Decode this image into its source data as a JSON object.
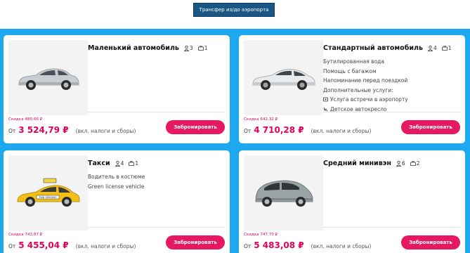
{
  "header": {
    "transfer_button": "Трансфер из/до аэропорта"
  },
  "colors": {
    "panel": "#1ea8f0",
    "accent": "#e3005a",
    "header_button": "#1a5683"
  },
  "cards": [
    {
      "title": "Маленький автомобиль",
      "passengers": "3",
      "luggage": "1",
      "features": [],
      "extras_label": "",
      "extras": [],
      "discount": "Скидка 480,66 ₽",
      "price_from": "От",
      "price": "3 524,79 ₽",
      "price_note": "(вкл. налоги и сборы)",
      "book_label": "Забронировать",
      "car_icon": "sedan-silver",
      "car_color": "#c9ccd0"
    },
    {
      "title": "Стандартный автомобиль",
      "passengers": "4",
      "luggage": "1",
      "features": [
        "Бутилированная вода",
        "Помощь с багажом",
        "Напоминание перед поездкой"
      ],
      "extras_label": "Дополнительные услуги:",
      "extras": [
        {
          "icon": "meet-greet-icon",
          "label": "Услуга встречи в аэропорту"
        },
        {
          "icon": "child-seat-icon",
          "label": "Детское автокресло"
        }
      ],
      "discount": "Скидка 642,32 ₽",
      "price_from": "От",
      "price": "4 710,28 ₽",
      "price_note": "(вкл. налоги и сборы)",
      "book_label": "Забронировать",
      "car_icon": "sedan-white",
      "car_color": "#e9eaec"
    },
    {
      "title": "Такси",
      "passengers": "4",
      "luggage": "1",
      "features": [
        "Водитель в костюме",
        "Green license vehicle"
      ],
      "extras_label": "",
      "extras": [],
      "discount": "Скидка 743,87 ₽",
      "price_from": "От",
      "price": "5 455,04 ₽",
      "price_note": "(вкл. налоги и сборы)",
      "book_label": "Забронировать",
      "car_icon": "taxi-yellow",
      "car_color": "#f2c018",
      "taxi_sign": "TAXI 0000000"
    },
    {
      "title": "Средний минивэн",
      "passengers": "6",
      "luggage": "2",
      "features": [],
      "extras_label": "",
      "extras": [],
      "discount": "Скидка 747,70 ₽",
      "price_from": "От",
      "price": "5 483,08 ₽",
      "price_note": "(вкл. налоги и сборы)",
      "book_label": "Забронировать",
      "car_icon": "minivan-grey",
      "car_color": "#9aa3a4"
    }
  ]
}
